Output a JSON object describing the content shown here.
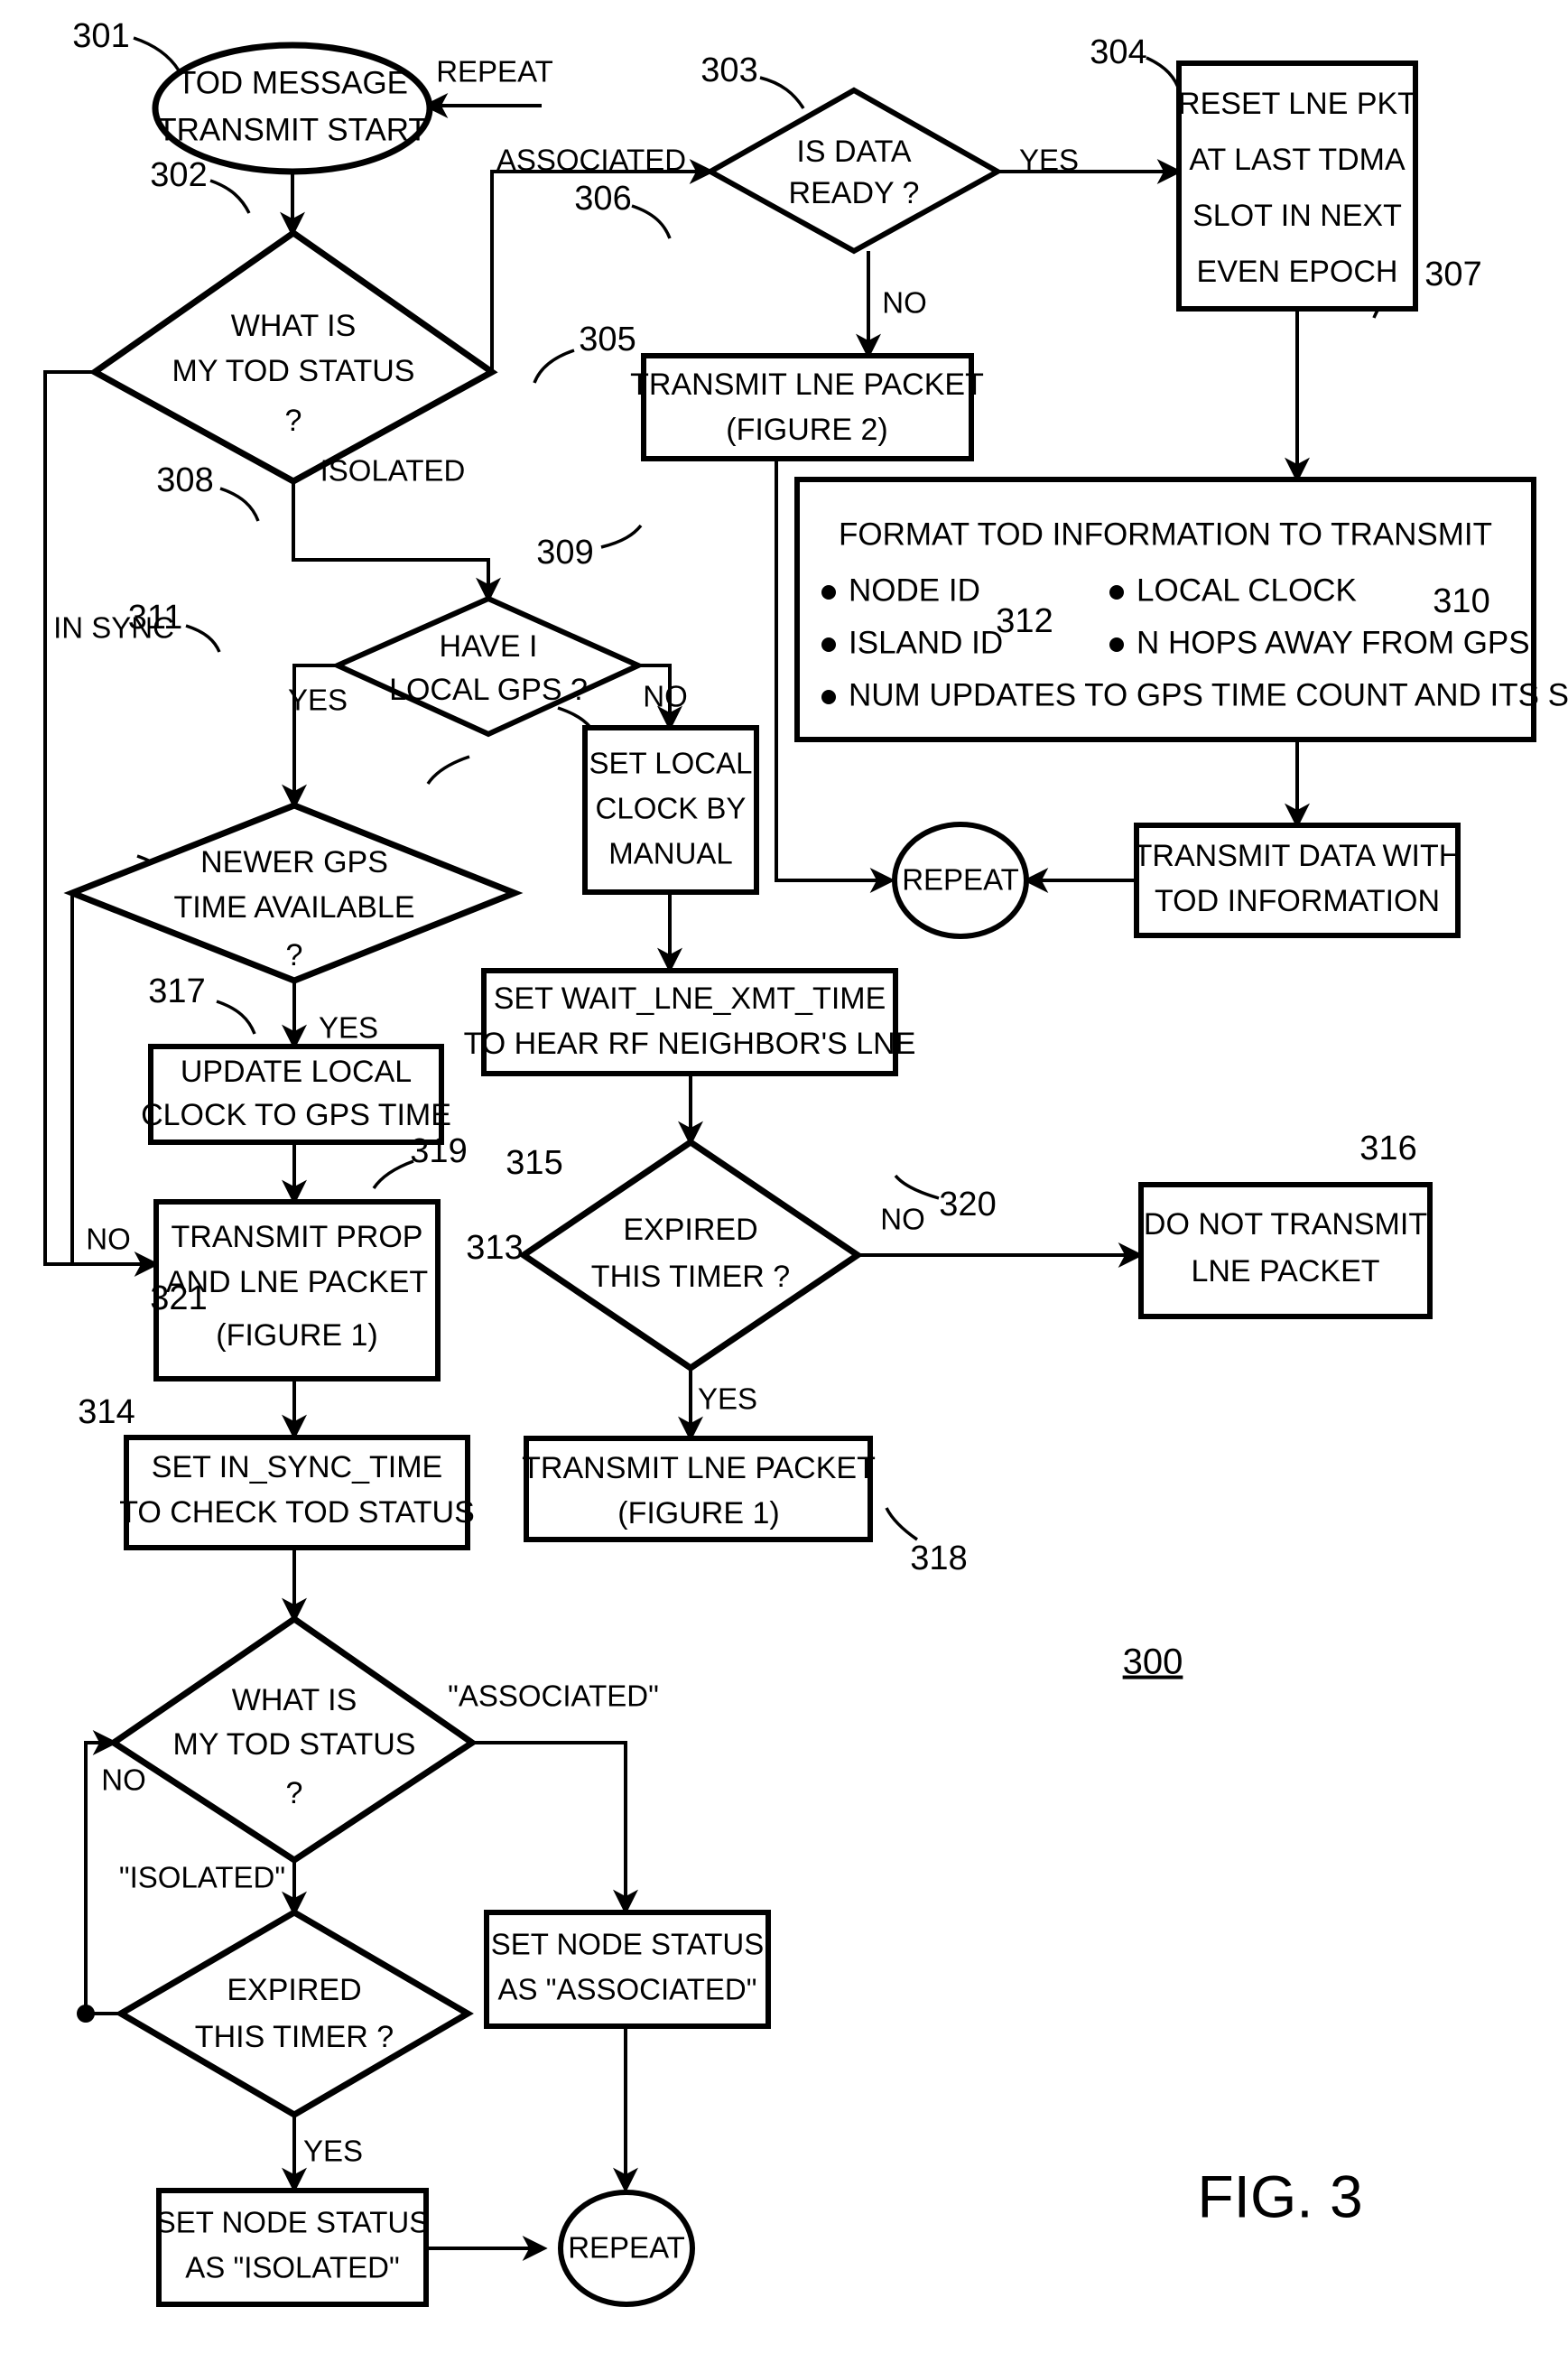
{
  "figure": {
    "figure_label": "FIG. 3",
    "assembly_ref": "300"
  },
  "nodes": {
    "n301": {
      "ref": "301",
      "shape": "terminator",
      "lines": [
        "TOD MESSAGE",
        "TRANSMIT START"
      ]
    },
    "n302": {
      "ref": "302",
      "shape": "decision",
      "lines": [
        "WHAT IS",
        "MY TOD STATUS",
        "?"
      ]
    },
    "n303": {
      "ref": "303",
      "shape": "decision",
      "lines": [
        "IS DATA",
        "READY ?"
      ]
    },
    "n304": {
      "ref": "304",
      "shape": "process",
      "lines": [
        "RESET LNE PKT",
        "AT LAST TDMA",
        "SLOT IN NEXT",
        "EVEN EPOCH"
      ]
    },
    "n305": {
      "ref": "305",
      "shape": "decision",
      "lines": [
        "HAVE I",
        "LOCAL GPS ?"
      ]
    },
    "n306": {
      "ref": "306",
      "shape": "process",
      "lines": [
        "TRANSMIT LNE PACKET",
        "(FIGURE 2)"
      ]
    },
    "n307": {
      "ref": "307",
      "shape": "process",
      "title": "FORMAT TOD INFORMATION TO TRANSMIT",
      "bullets_left": [
        "NODE ID",
        "ISLAND ID"
      ],
      "bullets_right": [
        "LOCAL CLOCK",
        "N HOPS AWAY FROM GPS"
      ],
      "bullets_full": [
        "NUM UPDATES TO GPS TIME COUNT AND ITS SIGN"
      ]
    },
    "n308": {
      "ref": "308",
      "shape": "decision",
      "lines": [
        "NEWER GPS",
        "TIME AVAILABLE",
        "?"
      ]
    },
    "n309": {
      "ref": "309",
      "shape": "process",
      "lines": [
        "SET LOCAL",
        "CLOCK BY",
        "MANUAL"
      ]
    },
    "n310": {
      "ref": "310",
      "shape": "process",
      "lines": [
        "TRANSMIT DATA WITH",
        "TOD INFORMATION"
      ]
    },
    "n311": {
      "ref": "311",
      "shape": "process",
      "lines": [
        "UPDATE LOCAL",
        "CLOCK TO GPS TIME"
      ]
    },
    "n312": {
      "ref": "312",
      "shape": "process",
      "lines": [
        "SET WAIT_LNE_XMT_TIME",
        "TO HEAR RF NEIGHBOR'S LNE"
      ]
    },
    "n313": {
      "ref": "313",
      "shape": "process",
      "lines": [
        "TRANSMIT PROP",
        "AND LNE PACKET",
        "(FIGURE 1)"
      ]
    },
    "n314": {
      "ref": "314",
      "shape": "process",
      "lines": [
        "SET IN_SYNC_TIME",
        "TO CHECK TOD STATUS"
      ]
    },
    "n315": {
      "ref": "315",
      "shape": "decision",
      "lines": [
        "EXPIRED",
        "THIS TIMER ?"
      ]
    },
    "n316": {
      "ref": "316",
      "shape": "process",
      "lines": [
        "DO NOT TRANSMIT",
        "LNE PACKET"
      ]
    },
    "n317": {
      "ref": "317",
      "shape": "decision",
      "lines": [
        "WHAT IS",
        "MY TOD STATUS",
        "?"
      ]
    },
    "n318": {
      "ref": "318",
      "shape": "process",
      "lines": [
        "TRANSMIT LNE PACKET",
        "(FIGURE 1)"
      ]
    },
    "n319": {
      "ref": "319",
      "shape": "decision",
      "lines": [
        "EXPIRED",
        "THIS TIMER ?"
      ]
    },
    "n320": {
      "ref": "320",
      "shape": "process",
      "lines": [
        "SET NODE STATUS",
        "AS \"ASSOCIATED\""
      ]
    },
    "n321": {
      "ref": "321",
      "shape": "process",
      "lines": [
        "SET NODE STATUS",
        "AS \"ISOLATED\""
      ]
    },
    "repeat_mid": {
      "shape": "connector",
      "lines": [
        "REPEAT"
      ]
    },
    "repeat_bottom": {
      "shape": "connector",
      "lines": [
        "REPEAT"
      ]
    }
  },
  "edge_labels": {
    "repeat_top": "REPEAT",
    "associated_302": "ASSOCIATED",
    "isolated_302": "ISOLATED",
    "in_sync_302": "IN SYNC",
    "yes_303": "YES",
    "no_303": "NO",
    "yes_305": "YES",
    "no_305": "NO",
    "yes_308": "YES",
    "no_308": "NO",
    "no_315": "NO",
    "yes_315": "YES",
    "associated_317": "\"ASSOCIATED\"",
    "isolated_317": "\"ISOLATED\"",
    "no_317": "NO",
    "yes_319": "YES"
  }
}
